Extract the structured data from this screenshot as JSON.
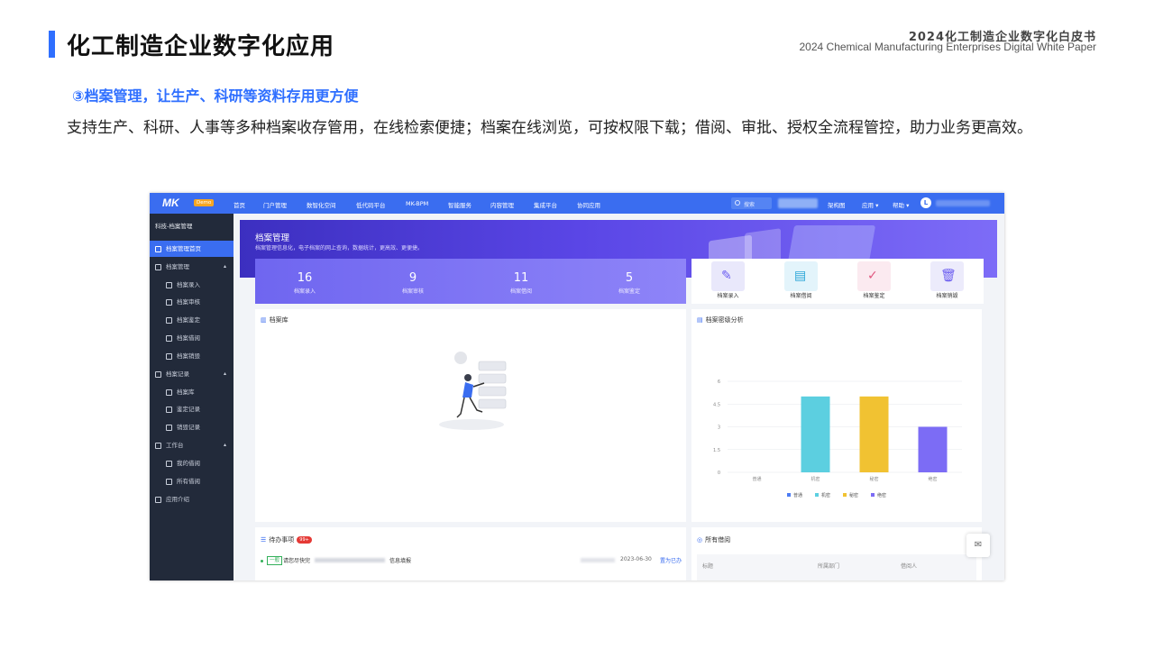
{
  "slide": {
    "title": "化工制造企业数字化应用",
    "whitepaper_cn": "2024化工制造企业数字化白皮书",
    "whitepaper_en": "2024 Chemical Manufacturing Enterprises Digital White Paper",
    "section_title": "③档案管理，让生产、科研等资料存用更方便",
    "body": "支持生产、科研、人事等多种档案收存管用，在线检索便捷；档案在线浏览，可按权限下载；借阅、审批、授权全流程管控，助力业务更高效。"
  },
  "app": {
    "logo": "MK",
    "logo_badge": "Demo",
    "nav": [
      "首页",
      "门户管理",
      "数智化空间",
      "低代码平台",
      "MK-BPM",
      "智能服务",
      "内容管理",
      "集成平台",
      "协同应用"
    ],
    "search_placeholder": "搜索",
    "nav_right": [
      "架构图",
      "应用 ▾",
      "帮助 ▾"
    ],
    "avatar": "L",
    "sidebar": {
      "header": "科技-档案管理",
      "items": [
        {
          "label": "档案管理首页",
          "icon": "home-icon",
          "active": true
        },
        {
          "label": "档案管理",
          "icon": "folder-icon",
          "caret": "▴"
        },
        {
          "label": "档案录入",
          "icon": "entry-icon"
        },
        {
          "label": "档案审核",
          "icon": "user-check-icon"
        },
        {
          "label": "档案鉴定",
          "icon": "appraise-icon"
        },
        {
          "label": "档案借阅",
          "icon": "borrow-icon"
        },
        {
          "label": "档案销毁",
          "icon": "destroy-icon"
        },
        {
          "label": "档案记录",
          "icon": "folder-icon",
          "caret": "▴"
        },
        {
          "label": "档案库",
          "icon": "file-icon"
        },
        {
          "label": "鉴定记录",
          "icon": "edit-icon"
        },
        {
          "label": "销毁记录",
          "icon": "scissors-icon"
        },
        {
          "label": "工作台",
          "icon": "folder-icon",
          "caret": "▴"
        },
        {
          "label": "我的借阅",
          "icon": "user-icon"
        },
        {
          "label": "所有借阅",
          "icon": "eye-icon"
        },
        {
          "label": "应用介绍",
          "icon": "doc-icon"
        }
      ]
    },
    "banner": {
      "title": "档案管理",
      "subtitle": "档案管理信息化，电子档案的网上查询，数据统计，更高效、更便捷。"
    },
    "stats": [
      {
        "value": "16",
        "label": "档案录入"
      },
      {
        "value": "9",
        "label": "档案审核"
      },
      {
        "value": "11",
        "label": "档案借阅"
      },
      {
        "value": "5",
        "label": "档案鉴定"
      }
    ],
    "quick": [
      {
        "label": "档案录入",
        "icon": "✎",
        "bg": "#e9e8fb",
        "fg": "#6a5cf0"
      },
      {
        "label": "档案借阅",
        "icon": "▤",
        "bg": "#e3f4fb",
        "fg": "#2aa6d8"
      },
      {
        "label": "档案鉴定",
        "icon": "✓",
        "bg": "#fbeaf0",
        "fg": "#e0577f"
      },
      {
        "label": "档案销毁",
        "icon": "🗑",
        "bg": "#ecebfb",
        "fg": "#6a5cf0"
      }
    ],
    "library_title": "档案库",
    "secrecy_title": "档案密级分析",
    "todo_title": "待办事项",
    "todo_badge": "99+",
    "todo_item": {
      "tag": "一般",
      "prefix": "请您尽快完",
      "suffix": "信息填报",
      "date": "2023-06-30",
      "action": "置为已办"
    },
    "borrow_title": "所有借阅",
    "borrow_columns": [
      "标题",
      "所属部门",
      "借阅人"
    ]
  },
  "chart_data": {
    "type": "bar",
    "categories": [
      "普通",
      "机密",
      "秘密",
      "绝密"
    ],
    "values": [
      0,
      5,
      5,
      3
    ],
    "colors": [
      "#4c7cf3",
      "#5ccfe0",
      "#f1c232",
      "#7c6cf5"
    ],
    "yticks": [
      "0",
      "1.5",
      "3",
      "4.5",
      "6"
    ],
    "ylim": [
      0,
      6
    ],
    "legend": [
      "普通",
      "机密",
      "秘密",
      "绝密"
    ],
    "legend_position": "bottom"
  }
}
